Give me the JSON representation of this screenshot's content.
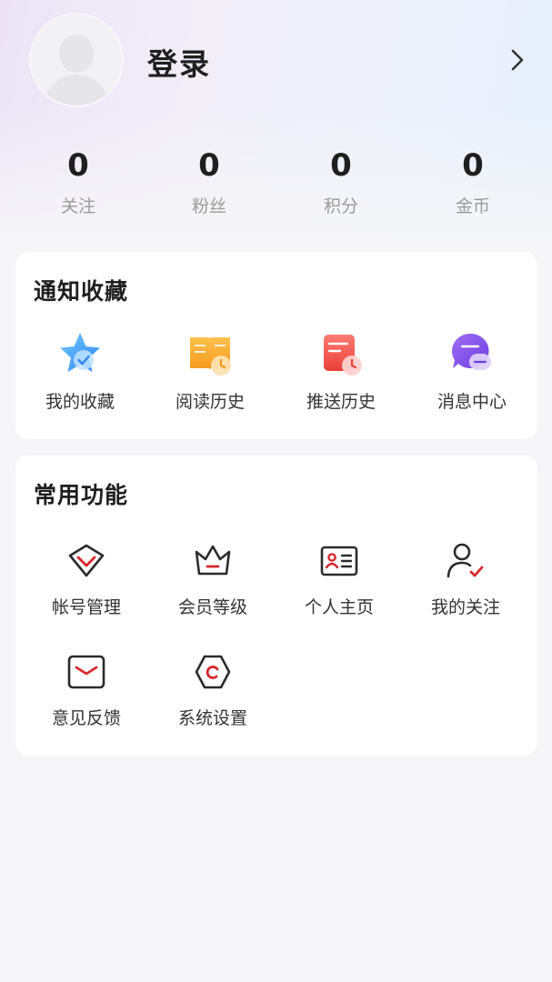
{
  "header": {
    "login_label": "登录",
    "avatar_icon": "default-avatar-icon",
    "chevron_icon": "chevron-right-icon"
  },
  "stats": [
    {
      "value": "0",
      "label": "关注"
    },
    {
      "value": "0",
      "label": "粉丝"
    },
    {
      "value": "0",
      "label": "积分"
    },
    {
      "value": "0",
      "label": "金币"
    }
  ],
  "notify_card": {
    "title": "通知收藏",
    "items": [
      {
        "label": "我的收藏",
        "icon": "star-favorite-icon"
      },
      {
        "label": "阅读历史",
        "icon": "book-history-icon"
      },
      {
        "label": "推送历史",
        "icon": "push-history-icon"
      },
      {
        "label": "消息中心",
        "icon": "message-center-icon"
      }
    ]
  },
  "common_card": {
    "title": "常用功能",
    "items": [
      {
        "label": "帐号管理",
        "icon": "account-manage-icon"
      },
      {
        "label": "会员等级",
        "icon": "crown-icon"
      },
      {
        "label": "个人主页",
        "icon": "profile-card-icon"
      },
      {
        "label": "我的关注",
        "icon": "user-follow-icon"
      },
      {
        "label": "意见反馈",
        "icon": "envelope-feedback-icon"
      },
      {
        "label": "系统设置",
        "icon": "settings-hexagon-icon"
      }
    ]
  },
  "colors": {
    "accent_red": "#d8262c",
    "dark_stroke": "#2b2b2b",
    "secondary_text": "#9a9a9a"
  }
}
